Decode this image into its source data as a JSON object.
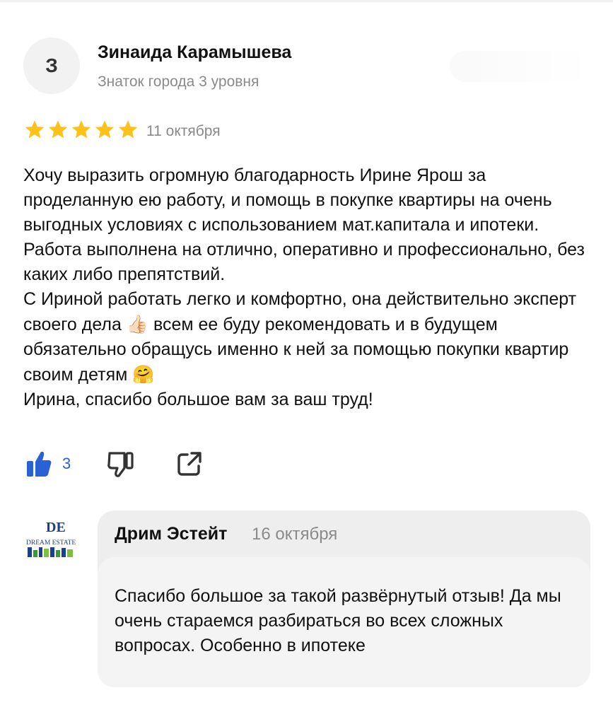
{
  "review": {
    "avatar_letter": "З",
    "author_name": "Зинаида Карамышева",
    "author_level": "Знаток города 3 уровня",
    "rating": 5,
    "date": "11 октября",
    "text_lines": [
      "Хочу выразить огромную благодарность Ирине Ярош за проделанную ею работу, и помощь в покупке квартиры на очень выгодных условиях с использованием мат.капитала и ипотеки. Работа выполнена на отлично, оперативно и профессионально, без каких либо препятствий.",
      "С Ириной работать легко и комфортно, она действительно эксперт своего дела",
      "всем ее буду рекомендовать и в будущем обязательно обращусь именно к ней за помощью покупки квартир своим детям",
      "Ирина, спасибо большое вам за ваш труд!"
    ],
    "emoji_thumb": "👍🏻",
    "emoji_hug": "🤗",
    "like_count": "3",
    "star_color": "#fcc21b",
    "accent_color": "#2a62d6"
  },
  "reply": {
    "logo_text": "DREAM ESTATE",
    "logo_mark": "DE",
    "author": "Дрим Эстейт",
    "date": "16 октября",
    "text": "Спасибо большое за такой развёрнутый отзыв! Да мы очень стараемся разбираться во всех сложных вопросах. Особенно в ипотеке"
  }
}
